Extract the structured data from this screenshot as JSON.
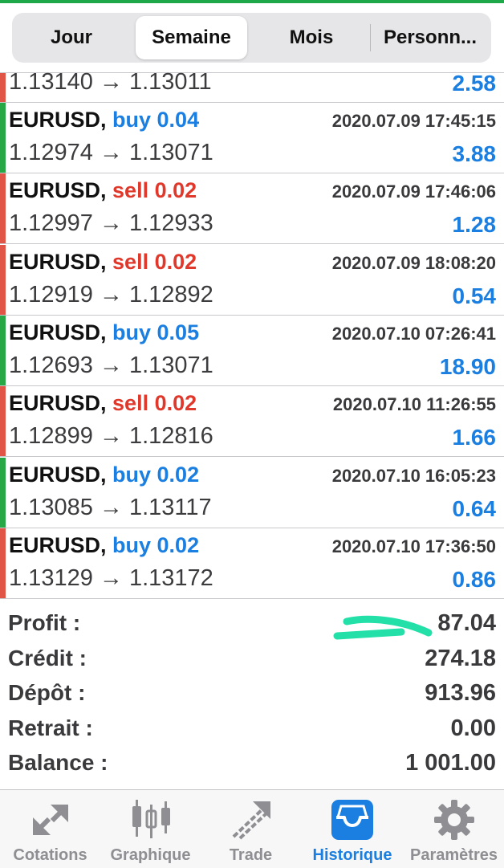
{
  "segments": [
    "Jour",
    "Semaine",
    "Mois",
    "Personn..."
  ],
  "active_segment": "Semaine",
  "partial_row": {
    "prices": "1.13140 → 1.13011",
    "profit": "2.58",
    "side": "sell"
  },
  "deals": [
    {
      "symbol": "EURUSD,",
      "side": "buy",
      "volume": "buy 0.04",
      "time": "2020.07.09 17:45:15",
      "prices": "1.12974 → 1.13071",
      "profit": "3.88"
    },
    {
      "symbol": "EURUSD,",
      "side": "sell",
      "volume": "sell 0.02",
      "time": "2020.07.09 17:46:06",
      "prices": "1.12997 → 1.12933",
      "profit": "1.28"
    },
    {
      "symbol": "EURUSD,",
      "side": "sell",
      "volume": "sell 0.02",
      "time": "2020.07.09 18:08:20",
      "prices": "1.12919 → 1.12892",
      "profit": "0.54"
    },
    {
      "symbol": "EURUSD,",
      "side": "buy",
      "volume": "buy 0.05",
      "time": "2020.07.10 07:26:41",
      "prices": "1.12693 → 1.13071",
      "profit": "18.90"
    },
    {
      "symbol": "EURUSD,",
      "side": "sell",
      "volume": "sell 0.02",
      "time": "2020.07.10 11:26:55",
      "prices": "1.12899 → 1.12816",
      "profit": "1.66"
    },
    {
      "symbol": "EURUSD,",
      "side": "buy",
      "volume": "buy 0.02",
      "time": "2020.07.10 16:05:23",
      "prices": "1.13085 → 1.13117",
      "profit": "0.64"
    },
    {
      "symbol": "EURUSD,",
      "side": "sell",
      "volume": "buy 0.02",
      "time": "2020.07.10 17:36:50",
      "prices": "1.13129 → 1.13172",
      "profit": "0.86"
    }
  ],
  "summary": [
    {
      "label": "Profit :",
      "value": "87.04"
    },
    {
      "label": "Crédit :",
      "value": "274.18"
    },
    {
      "label": "Dépôt :",
      "value": "913.96"
    },
    {
      "label": "Retrait :",
      "value": "0.00"
    },
    {
      "label": "Balance :",
      "value": "1 001.00"
    }
  ],
  "tabs": [
    {
      "label": "Cotations",
      "icon": "quotes-arrows-icon"
    },
    {
      "label": "Graphique",
      "icon": "candlestick-chart-icon"
    },
    {
      "label": "Trade",
      "icon": "trade-trend-icon"
    },
    {
      "label": "Historique",
      "icon": "history-inbox-icon"
    },
    {
      "label": "Paramètres",
      "icon": "settings-gear-icon"
    }
  ],
  "active_tab": "Historique",
  "colors": {
    "buy": "#1a7fe0",
    "sell": "#e0382a",
    "buy_bar": "#27a745",
    "sell_bar": "#e05545",
    "profit": "#1a7fe0",
    "annotation": "#22e0a8"
  }
}
